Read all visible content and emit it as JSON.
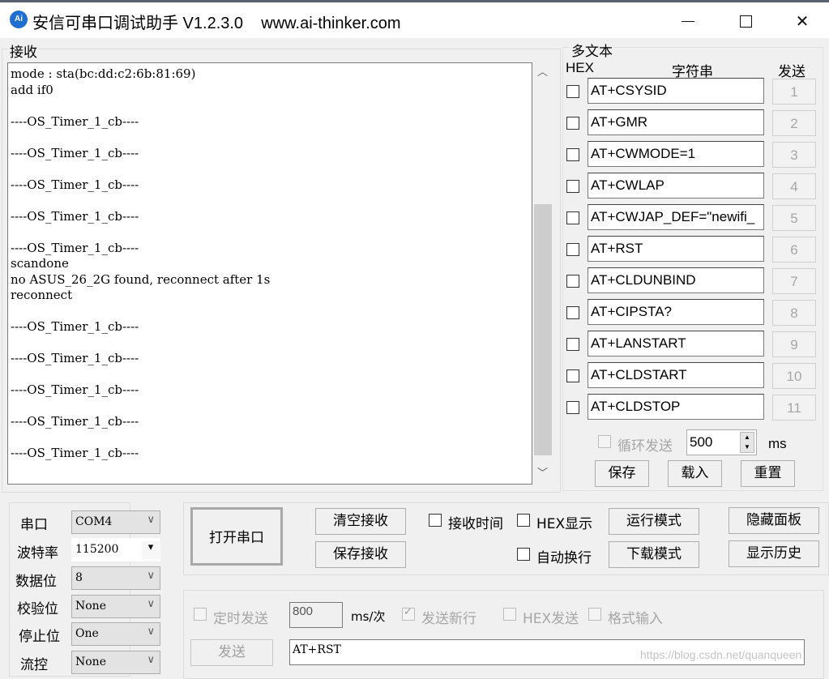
{
  "window": {
    "title": "安信可串口调试助手 V1.2.3.0    www.ai-thinker.com",
    "icon_label": "Ai",
    "minimize": "minimize-icon",
    "maximize": "maximize-icon",
    "close": "close-icon"
  },
  "receive": {
    "group_label": "接收",
    "text": "mode : sta(bc:dd:c2:6b:81:69)\nadd if0\n\n----OS_Timer_1_cb----\n\n----OS_Timer_1_cb----\n\n----OS_Timer_1_cb----\n\n----OS_Timer_1_cb----\n\n----OS_Timer_1_cb----\nscandone\nno ASUS_26_2G found, reconnect after 1s\nreconnect\n\n----OS_Timer_1_cb----\n\n----OS_Timer_1_cb----\n\n----OS_Timer_1_cb----\n\n----OS_Timer_1_cb----\n\n----OS_Timer_1_cb----",
    "scroll_up": "▲",
    "scroll_down": "▼"
  },
  "multi": {
    "group_label": "多文本",
    "col_hex": "HEX",
    "col_string": "字符串",
    "col_send": "发送",
    "rows": [
      {
        "hex": false,
        "value": "AT+CSYSID",
        "send": "1"
      },
      {
        "hex": false,
        "value": "AT+GMR",
        "send": "2"
      },
      {
        "hex": false,
        "value": "AT+CWMODE=1",
        "send": "3"
      },
      {
        "hex": false,
        "value": "AT+CWLAP",
        "send": "4"
      },
      {
        "hex": false,
        "value": "AT+CWJAP_DEF=\"newifi_",
        "send": "5"
      },
      {
        "hex": false,
        "value": "AT+RST",
        "send": "6"
      },
      {
        "hex": false,
        "value": "AT+CLDUNBIND",
        "send": "7"
      },
      {
        "hex": false,
        "value": "AT+CIPSTA?",
        "send": "8"
      },
      {
        "hex": false,
        "value": "AT+LANSTART",
        "send": "9"
      },
      {
        "hex": false,
        "value": "AT+CLDSTART",
        "send": "10"
      },
      {
        "hex": false,
        "value": "AT+CLDSTOP",
        "send": "11"
      }
    ],
    "loop_send_label": "循环发送",
    "loop_interval": "500",
    "loop_unit": "ms",
    "save": "保存",
    "load": "载入",
    "reset": "重置"
  },
  "serial": {
    "port_label": "串口",
    "port_value": "COM4",
    "baud_label": "波特率",
    "baud_value": "115200",
    "databits_label": "数据位",
    "databits_value": "8",
    "parity_label": "校验位",
    "parity_value": "None",
    "stopbits_label": "停止位",
    "stopbits_value": "One",
    "flow_label": "流控",
    "flow_value": "None"
  },
  "controls": {
    "open_port": "打开串口",
    "clear_recv": "清空接收",
    "save_recv": "保存接收",
    "recv_time": "接收时间",
    "hex_display": "HEX显示",
    "auto_wrap": "自动换行",
    "run_mode": "运行模式",
    "download_mode": "下载模式",
    "hide_panel": "隐藏面板",
    "show_history": "显示历史"
  },
  "send": {
    "timed_send": "定时发送",
    "timer_value": "800",
    "timer_unit": "ms/次",
    "send_newline": "发送新行",
    "send_newline_checked": true,
    "hex_send": "HEX发送",
    "format_input": "格式输入",
    "send_button": "发送",
    "send_text": "AT+RST"
  },
  "watermark": "https://blog.csdn.net/quanqueen"
}
